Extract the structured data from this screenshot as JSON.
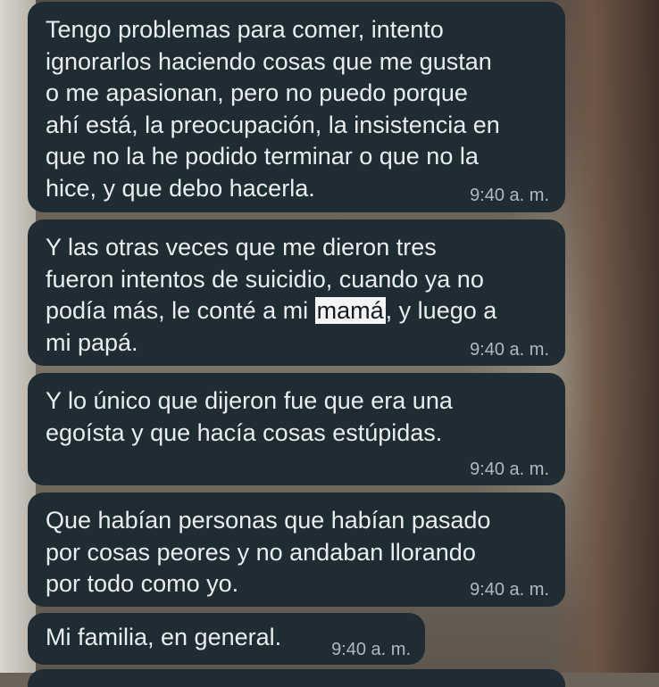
{
  "messages": [
    {
      "text": "Tengo problemas para comer, intento\nignorarlos haciendo cosas que me gustan\no me apasionan, pero no puedo porque\nahí está, la preocupación, la insistencia en\nque no la he podido terminar o que no la\nhice, y que debo hacerla.",
      "time": "9:40 a. m."
    },
    {
      "text_before": "Y las otras veces que me dieron tres\nfueron intentos de suicidio, cuando ya no\npodía más, le conté a mi ",
      "highlight": "mamá",
      "text_after": ", y luego a\nmi papá.",
      "time": "9:40 a. m."
    },
    {
      "text": "Y lo único que dijeron fue que era una\negoísta y que hacía cosas estúpidas.",
      "time": "9:40 a. m."
    },
    {
      "text": "Que habían personas que habían pasado\npor cosas peores y no andaban llorando\npor todo como yo.",
      "time": "9:40 a. m."
    },
    {
      "text": "Mi familia, en general.",
      "time": "9:40 a. m."
    }
  ],
  "colors": {
    "bubble_background": "#1f2c34",
    "message_text": "#e9edef",
    "timestamp_text": "#aebac1",
    "highlight_background": "#f5f5f5"
  }
}
